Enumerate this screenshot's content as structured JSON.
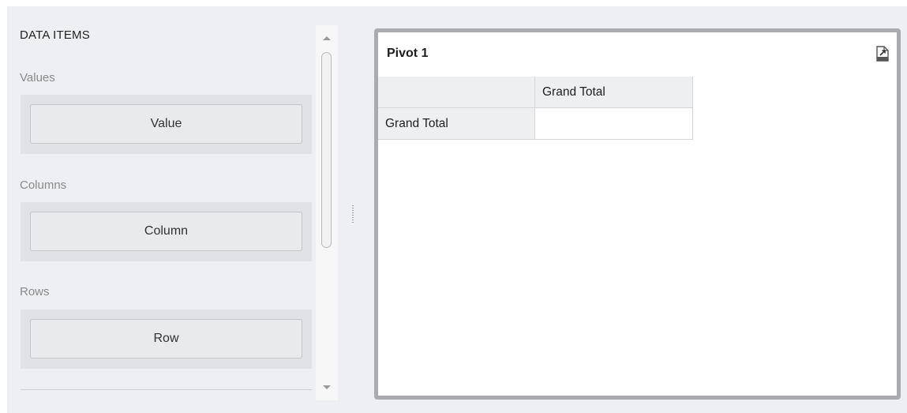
{
  "data_items": {
    "title": "DATA ITEMS",
    "sections": [
      {
        "label": "Values",
        "button": "Value"
      },
      {
        "label": "Columns",
        "button": "Column"
      },
      {
        "label": "Rows",
        "button": "Row"
      }
    ]
  },
  "pivot": {
    "title": "Pivot 1",
    "column_header": "Grand Total",
    "row_header": "Grand Total",
    "corner": "",
    "value": ""
  },
  "icons": {
    "export": "export-icon",
    "scroll_up": "scroll-up-arrow-icon",
    "scroll_down": "scroll-down-arrow-icon",
    "splitter": "splitter-grip-icon"
  },
  "colors": {
    "panel_background": "#eeeff2",
    "well_background": "#e1e2e5",
    "card_border": "#a9abae",
    "grid_header": "#eeeff1"
  }
}
